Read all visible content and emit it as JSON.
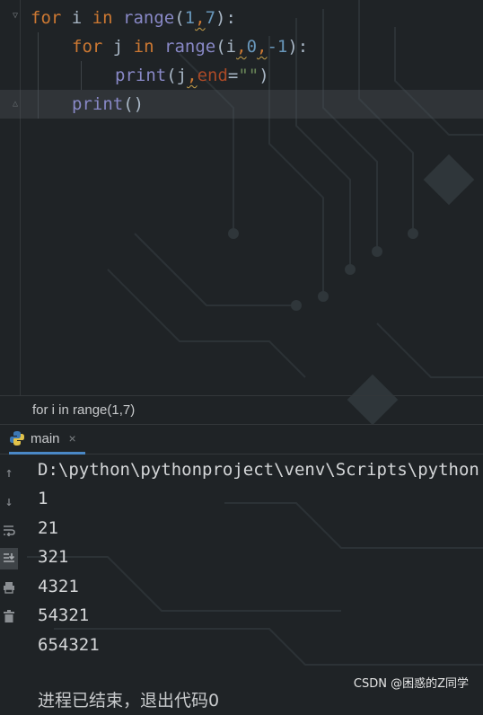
{
  "editor": {
    "line1": {
      "kw_for": "for",
      "var": " i ",
      "kw_in": "in",
      "fn": "range",
      "open": "(",
      "a1": "1",
      "sep": ",",
      "a2": "7",
      "close": "):"
    },
    "line2": {
      "kw_for": "for",
      "var": " j ",
      "kw_in": "in",
      "fn": "range",
      "open": "(",
      "a1": "i",
      "sep1": ",",
      "a2": "0",
      "sep2": ",",
      "a3": "-1",
      "close": "):"
    },
    "line3": {
      "fn": "print",
      "open": "(",
      "a1": "j",
      "sep": ",",
      "param": "end",
      "eq": "=",
      "str": "\"\"",
      "close": ")"
    },
    "line4": {
      "fn": "print",
      "parens": "()"
    }
  },
  "breadcrumb": {
    "text": "for i in range(1,7)"
  },
  "run_panel": {
    "tab_label": "main",
    "close_glyph": "×"
  },
  "console": {
    "lines": [
      "D:\\python\\pythonproject\\venv\\Scripts\\python",
      "1",
      "21",
      "321",
      "4321",
      "54321",
      "654321"
    ],
    "exit_message": "进程已结束，退出代码0"
  },
  "toolbar_icons": [
    "up-arrow-icon",
    "down-arrow-icon",
    "soft-wrap-icon",
    "scroll-to-end-icon",
    "print-icon",
    "trash-icon"
  ],
  "watermark": {
    "text": "CSDN @困惑的Z同学"
  }
}
